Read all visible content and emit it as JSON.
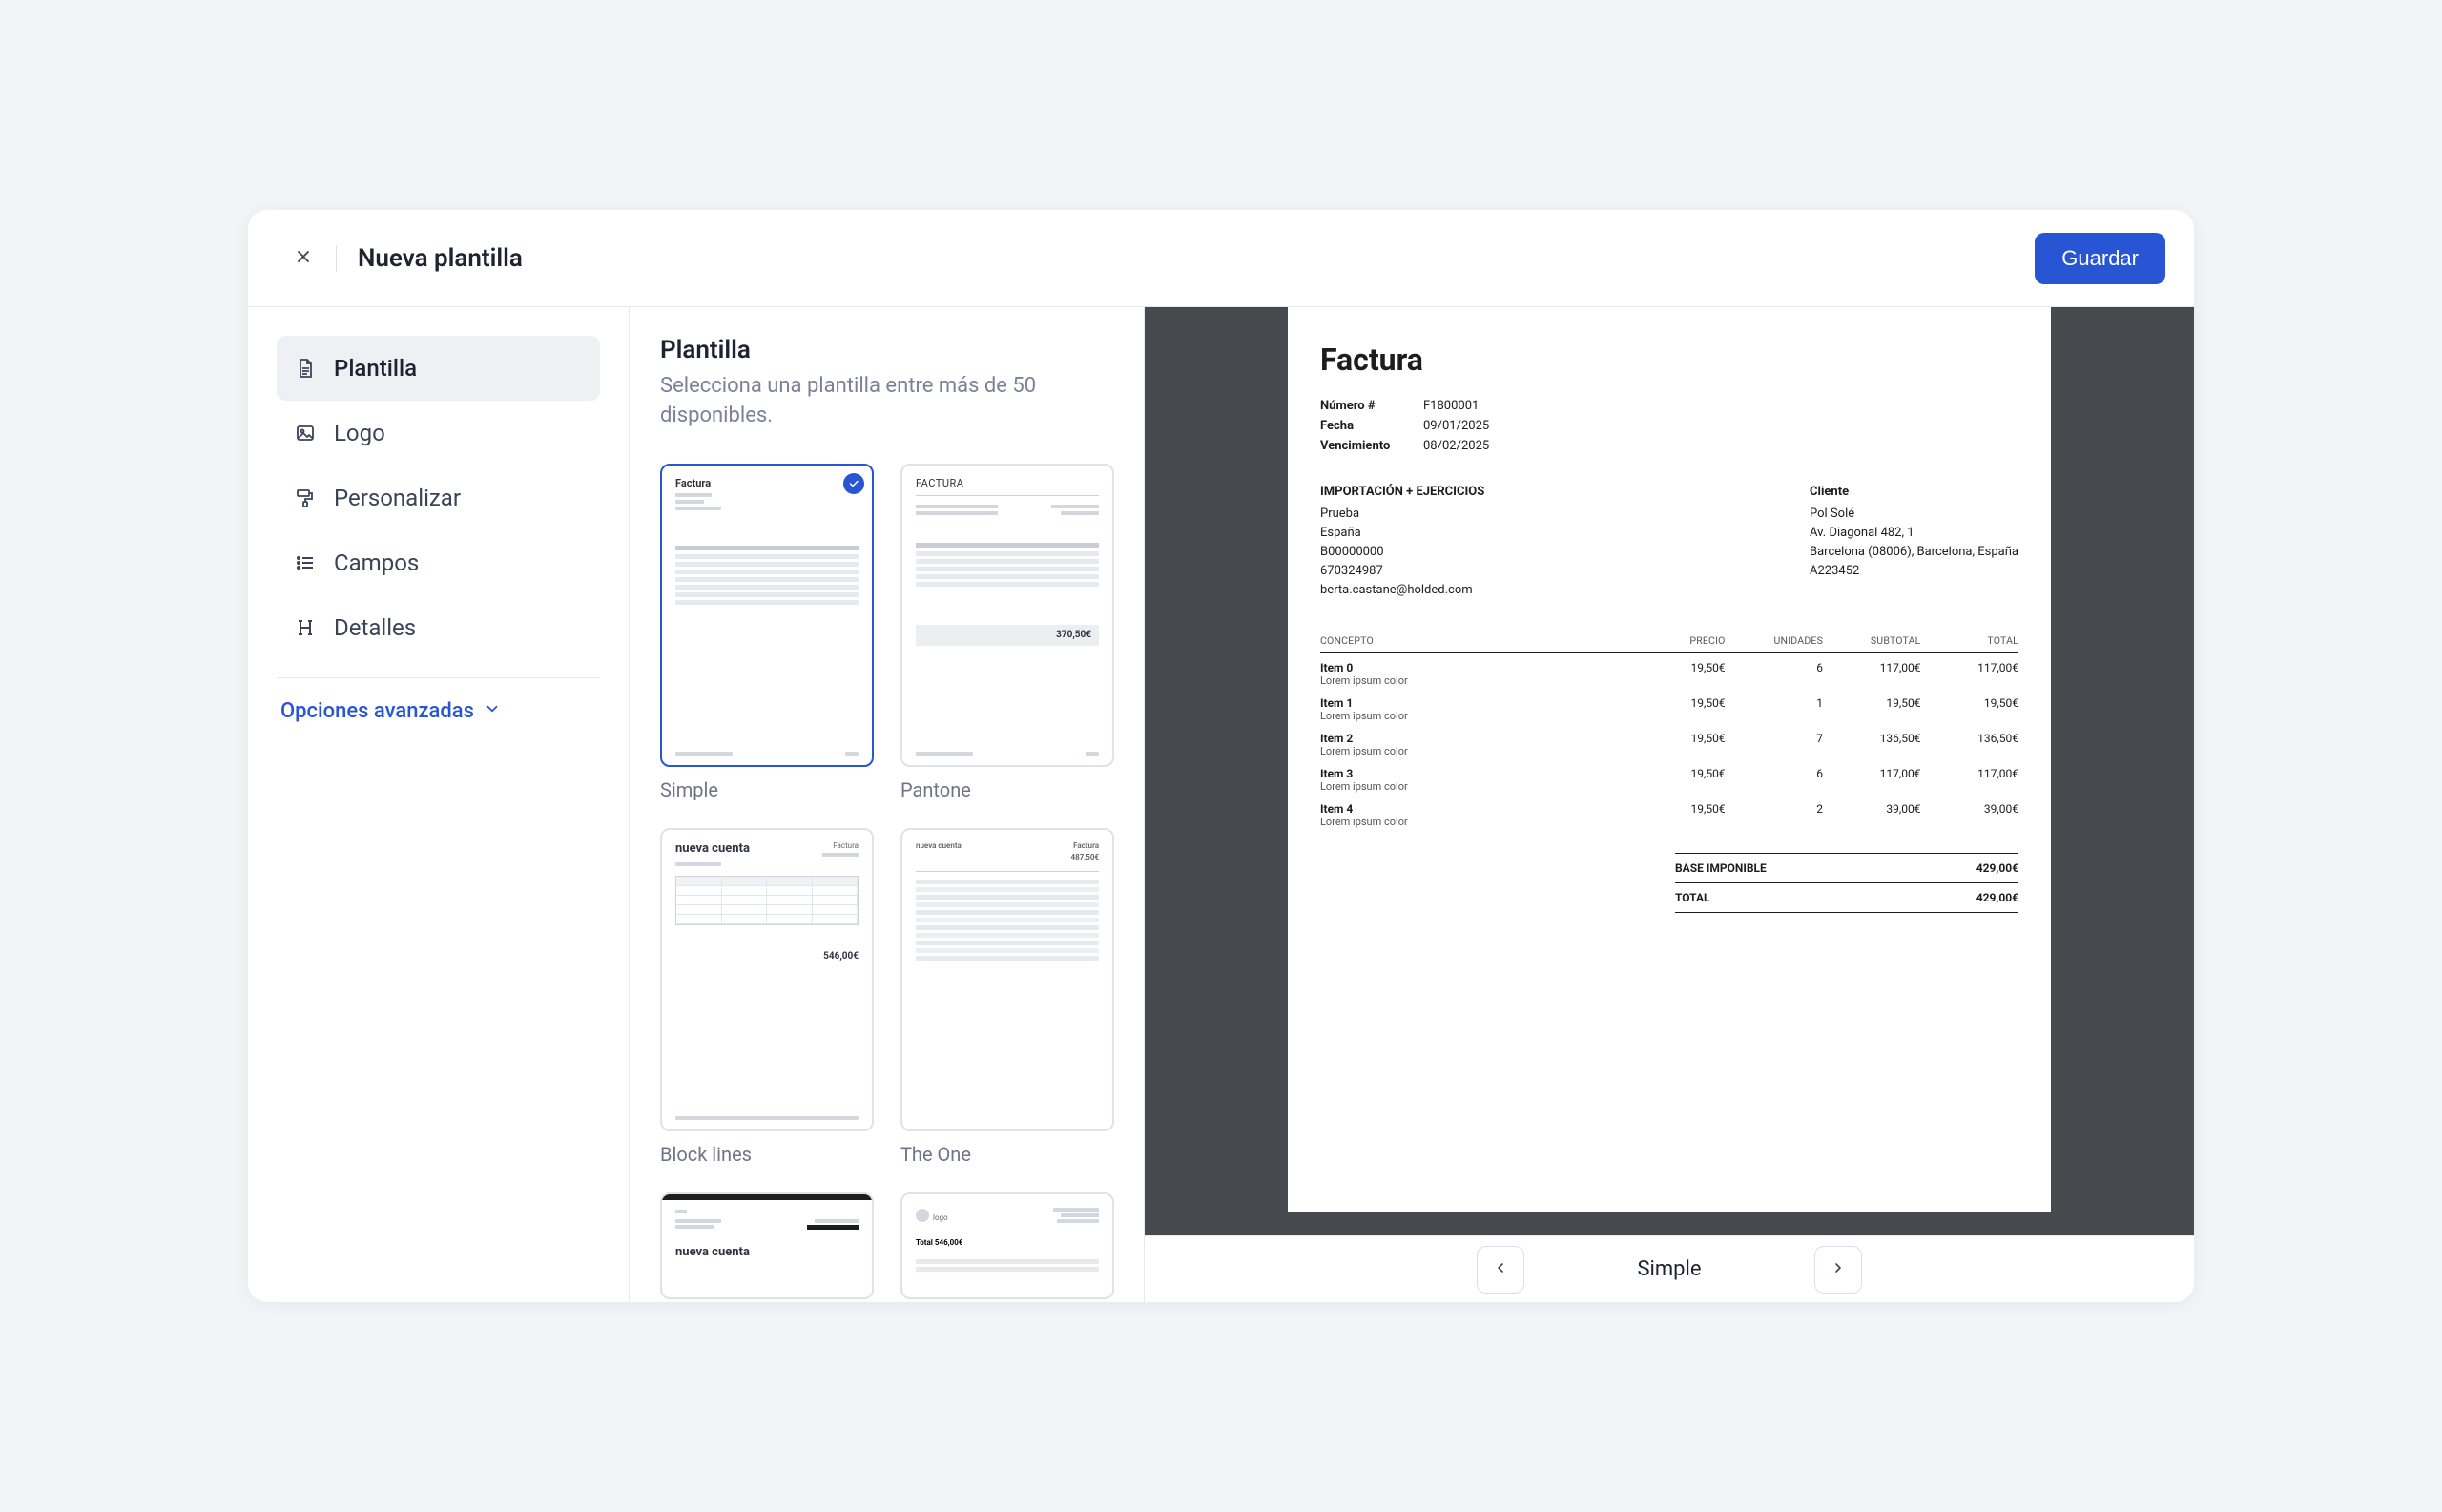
{
  "header": {
    "title": "Nueva plantilla",
    "save_label": "Guardar"
  },
  "sidebar": {
    "items": [
      {
        "label": "Plantilla",
        "icon": "document"
      },
      {
        "label": "Logo",
        "icon": "image"
      },
      {
        "label": "Personalizar",
        "icon": "roller"
      },
      {
        "label": "Campos",
        "icon": "list"
      },
      {
        "label": "Detalles",
        "icon": "heading"
      }
    ],
    "advanced_label": "Opciones avanzadas"
  },
  "center": {
    "title": "Plantilla",
    "subtitle": "Selecciona una plantilla entre más de 50 disponibles.",
    "templates": [
      {
        "label": "Simple",
        "selected": true,
        "thumb_title": "Factura"
      },
      {
        "label": "Pantone",
        "selected": false,
        "thumb_title": "FACTURA",
        "thumb_price": "370,50€"
      },
      {
        "label": "Block lines",
        "selected": false,
        "thumb_brand": "nueva cuenta",
        "thumb_tag": "Factura",
        "thumb_price": "546,00€"
      },
      {
        "label": "The One",
        "selected": false,
        "thumb_brand": "nueva cuenta",
        "thumb_tag": "Factura",
        "thumb_price": "487,50€"
      },
      {
        "label": "",
        "selected": false,
        "thumb_brand": "nueva cuenta"
      },
      {
        "label": "",
        "selected": false,
        "thumb_logo": "logo"
      }
    ]
  },
  "invoice": {
    "title": "Factura",
    "number_label": "Número #",
    "number": "F1800001",
    "date_label": "Fecha",
    "date": "09/01/2025",
    "due_label": "Vencimiento",
    "due": "08/02/2025",
    "sender": {
      "heading": "IMPORTACIÓN + EJERCICIOS",
      "name": "Prueba",
      "country": "España",
      "vat": "B00000000",
      "phone": "670324987",
      "email": "berta.castane@holded.com"
    },
    "client": {
      "heading": "Cliente",
      "name": "Pol Solé",
      "address1": "Av. Diagonal 482, 1",
      "address2": "Barcelona (08006), Barcelona, España",
      "code": "A223452"
    },
    "columns": {
      "concept": "CONCEPTO",
      "price": "PRECIO",
      "units": "UNIDADES",
      "subtotal": "SUBTOTAL",
      "total": "TOTAL"
    },
    "items": [
      {
        "name": "Item 0",
        "desc": "Lorem ipsum color",
        "price": "19,50€",
        "units": "6",
        "subtotal": "117,00€",
        "total": "117,00€"
      },
      {
        "name": "Item 1",
        "desc": "Lorem ipsum color",
        "price": "19,50€",
        "units": "1",
        "subtotal": "19,50€",
        "total": "19,50€"
      },
      {
        "name": "Item 2",
        "desc": "Lorem ipsum color",
        "price": "19,50€",
        "units": "7",
        "subtotal": "136,50€",
        "total": "136,50€"
      },
      {
        "name": "Item 3",
        "desc": "Lorem ipsum color",
        "price": "19,50€",
        "units": "6",
        "subtotal": "117,00€",
        "total": "117,00€"
      },
      {
        "name": "Item 4",
        "desc": "Lorem ipsum color",
        "price": "19,50€",
        "units": "2",
        "subtotal": "39,00€",
        "total": "39,00€"
      }
    ],
    "totals": {
      "base_label": "BASE IMPONIBLE",
      "base": "429,00€",
      "total_label": "TOTAL",
      "total": "429,00€"
    }
  },
  "footer": {
    "current_name": "Simple"
  }
}
